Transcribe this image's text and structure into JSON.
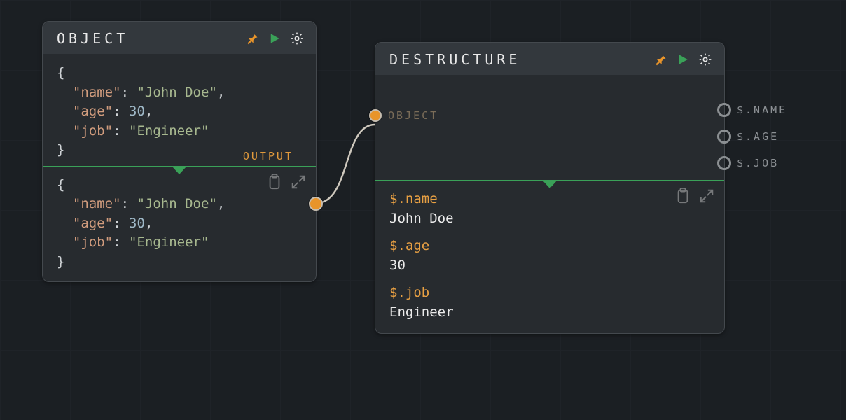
{
  "nodes": {
    "object": {
      "title": "OBJECT",
      "output_port_label": "OUTPUT",
      "source_json_display": "{\n  \"name\": \"John Doe\",\n  \"age\": 30,\n  \"job\": \"Engineer\"\n}",
      "result_json_display": "{\n  \"name\": \"John Doe\",\n  \"age\": 30,\n  \"job\": \"Engineer\"\n}",
      "fields": [
        {
          "key": "name",
          "value": "John Doe",
          "type": "string"
        },
        {
          "key": "age",
          "value": 30,
          "type": "number"
        },
        {
          "key": "job",
          "value": "Engineer",
          "type": "string"
        }
      ]
    },
    "destructure": {
      "title": "DESTRUCTURE",
      "input_port_label": "OBJECT",
      "output_ports": [
        {
          "label": "$.NAME"
        },
        {
          "label": "$.AGE"
        },
        {
          "label": "$.JOB"
        }
      ],
      "result_entries": [
        {
          "path": "$.name",
          "value": "John Doe"
        },
        {
          "path": "$.age",
          "value": "30"
        },
        {
          "path": "$.job",
          "value": "Engineer"
        }
      ]
    }
  },
  "icons": {
    "pin": "pin-icon",
    "run": "run-icon",
    "gear": "gear-icon",
    "copy": "clipboard-icon",
    "expand": "expand-icon"
  },
  "connections": [
    {
      "from": "object.output",
      "to": "destructure.input"
    }
  ]
}
